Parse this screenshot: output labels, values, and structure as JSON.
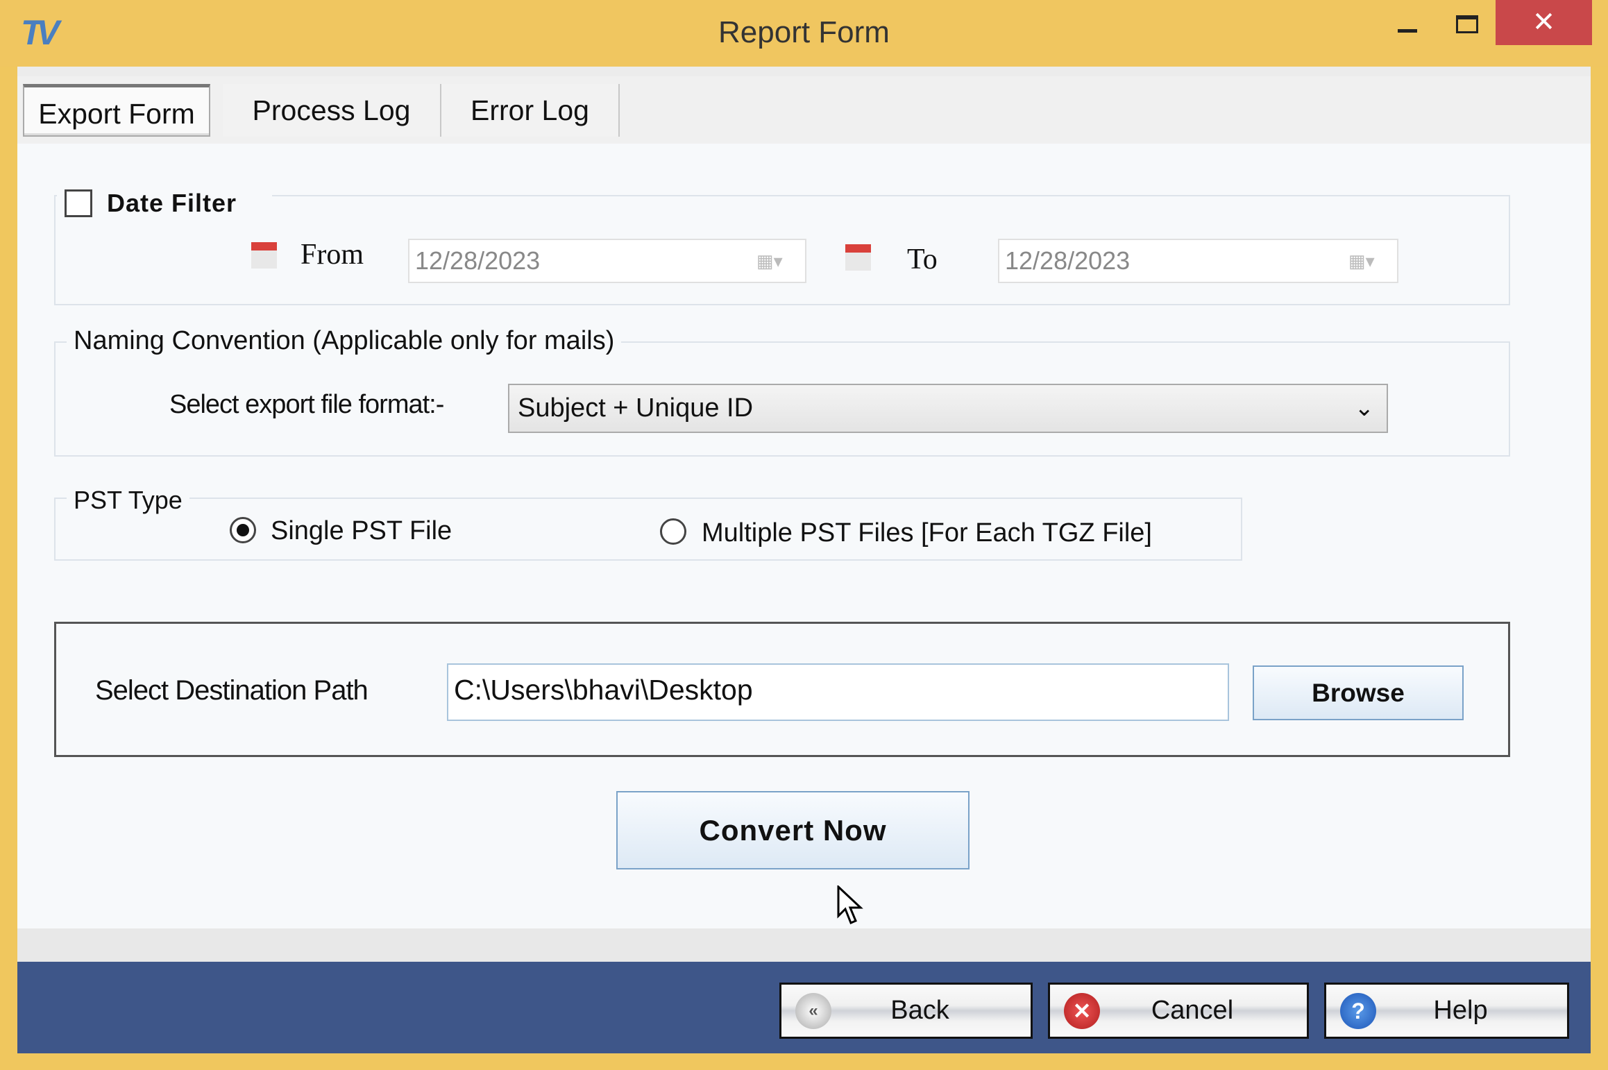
{
  "window": {
    "title": "Report Form",
    "logo": "TV",
    "close_glyph": "✕"
  },
  "tabs": [
    {
      "label": "Export Form",
      "active": true
    },
    {
      "label": "Process Log"
    },
    {
      "label": "Error Log"
    }
  ],
  "date_filter": {
    "label": "Date Filter",
    "checked": false,
    "from_label": "From",
    "from_value": "12/28/2023",
    "to_label": "To",
    "to_value": "12/28/2023"
  },
  "naming": {
    "legend": "Naming Convention (Applicable only for mails)",
    "format_label": "Select export file format:-",
    "format_value": "Subject + Unique ID"
  },
  "pst_type": {
    "legend": "PST Type",
    "options": [
      {
        "label": "Single PST File",
        "selected": true
      },
      {
        "label": "Multiple PST Files [For Each TGZ File]",
        "selected": false
      }
    ]
  },
  "destination": {
    "label": "Select Destination Path",
    "value": "C:\\Users\\bhavi\\Desktop",
    "browse_label": "Browse"
  },
  "convert_label": "Convert Now",
  "footer": {
    "back_label": "Back",
    "cancel_label": "Cancel",
    "help_label": "Help"
  },
  "colors": {
    "frame": "#f0c660",
    "close": "#c9484a",
    "bottom_bar": "#3e5689",
    "accent_border": "#7aa2c8"
  }
}
